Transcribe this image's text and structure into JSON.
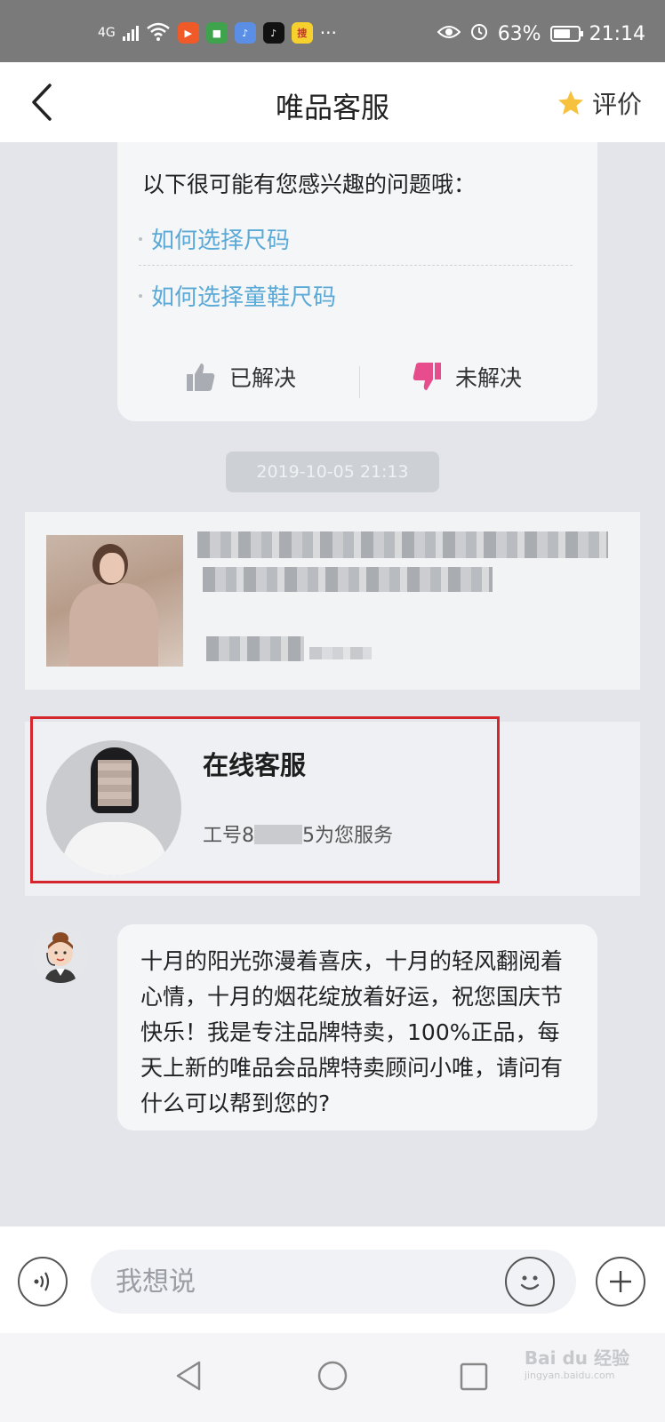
{
  "status_bar": {
    "network": "4G",
    "battery": "63%",
    "time": "21:14",
    "app_icons": [
      "video-app",
      "news-app",
      "music-app",
      "tiktok-app",
      "sohu-app"
    ],
    "more": "···"
  },
  "header": {
    "title": "唯品客服",
    "rate_label": "评价"
  },
  "faq": {
    "intro": "以下很可能有您感兴趣的问题哦：",
    "questions": [
      "如何选择尺码",
      "如何选择童鞋尺码"
    ],
    "solved_label": "已解决",
    "unsolved_label": "未解决"
  },
  "timestamp": "2019-10-05 21:13",
  "agent_card": {
    "name": "在线客服",
    "id_prefix": "工号8",
    "id_suffix": "5为您服务"
  },
  "bot_message": {
    "text": "十月的阳光弥漫着喜庆，十月的轻风翻阅着心情，十月的烟花绽放着好运，祝您国庆节快乐！我是专注品牌特卖，100%正品，每天上新的唯品会品牌特卖顾问小唯，请问有什么可以帮到您的?"
  },
  "input": {
    "placeholder": "我想说"
  },
  "watermark": {
    "brand": "Bai du 经验",
    "url": "jingyan.baidu.com"
  },
  "colors": {
    "accent_link": "#5aa9d6",
    "dislike": "#e74c8c",
    "highlight_box": "#d4262c"
  }
}
